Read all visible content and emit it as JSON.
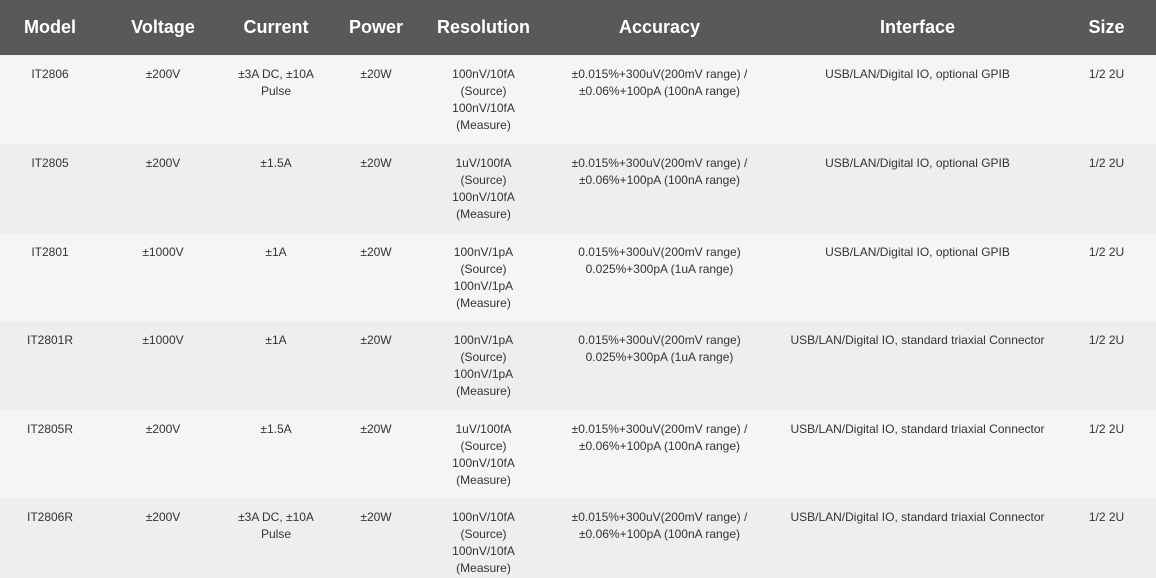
{
  "headers": {
    "model": "Model",
    "voltage": "Voltage",
    "current": "Current",
    "power": "Power",
    "resolution": "Resolution",
    "accuracy": "Accuracy",
    "interface": "Interface",
    "size": "Size"
  },
  "rows": [
    {
      "model": "IT2806",
      "voltage": "±200V",
      "current": [
        "±3A DC, ±10A",
        "Pulse"
      ],
      "power": "±20W",
      "resolution": [
        "100nV/10fA",
        "(Source)",
        "100nV/10fA",
        "(Measure)"
      ],
      "accuracy": [
        "±0.015%+300uV(200mV range) /",
        "±0.06%+100pA (100nA range)"
      ],
      "interface": "USB/LAN/Digital IO, optional GPIB",
      "size": "1/2 2U"
    },
    {
      "model": "IT2805",
      "voltage": "±200V",
      "current": [
        "±1.5A"
      ],
      "power": "±20W",
      "resolution": [
        "1uV/100fA",
        "(Source)",
        "100nV/10fA",
        "(Measure)"
      ],
      "accuracy": [
        "±0.015%+300uV(200mV range) /",
        "±0.06%+100pA (100nA range)"
      ],
      "interface": "USB/LAN/Digital IO, optional GPIB",
      "size": "1/2 2U"
    },
    {
      "model": "IT2801",
      "voltage": "±1000V",
      "current": [
        "±1A"
      ],
      "power": "±20W",
      "resolution": [
        "100nV/1pA",
        "(Source)",
        "100nV/1pA",
        "(Measure)"
      ],
      "accuracy": [
        "0.015%+300uV(200mV range)",
        "0.025%+300pA (1uA range)"
      ],
      "interface": "USB/LAN/Digital IO, optional GPIB",
      "size": "1/2 2U"
    },
    {
      "model": "IT2801R",
      "voltage": "±1000V",
      "current": [
        "±1A"
      ],
      "power": "±20W",
      "resolution": [
        "100nV/1pA",
        "(Source)",
        "100nV/1pA",
        "(Measure)"
      ],
      "accuracy": [
        "0.015%+300uV(200mV range)",
        "0.025%+300pA (1uA range)"
      ],
      "interface": "USB/LAN/Digital IO, standard triaxial Connector",
      "size": "1/2 2U"
    },
    {
      "model": "IT2805R",
      "voltage": "±200V",
      "current": [
        "±1.5A"
      ],
      "power": "±20W",
      "resolution": [
        "1uV/100fA",
        "(Source)",
        "100nV/10fA",
        "(Measure)"
      ],
      "accuracy": [
        "±0.015%+300uV(200mV range) /",
        "±0.06%+100pA (100nA range)"
      ],
      "interface": "USB/LAN/Digital IO, standard triaxial Connector",
      "size": "1/2 2U"
    },
    {
      "model": "IT2806R",
      "voltage": "±200V",
      "current": [
        "±3A DC, ±10A",
        "Pulse"
      ],
      "power": "±20W",
      "resolution": [
        "100nV/10fA",
        "(Source)",
        "100nV/10fA",
        "(Measure)"
      ],
      "accuracy": [
        "±0.015%+300uV(200mV range) /",
        "±0.06%+100pA (100nA range)"
      ],
      "interface": "USB/LAN/Digital IO, standard triaxial Connector",
      "size": "1/2 2U"
    }
  ]
}
